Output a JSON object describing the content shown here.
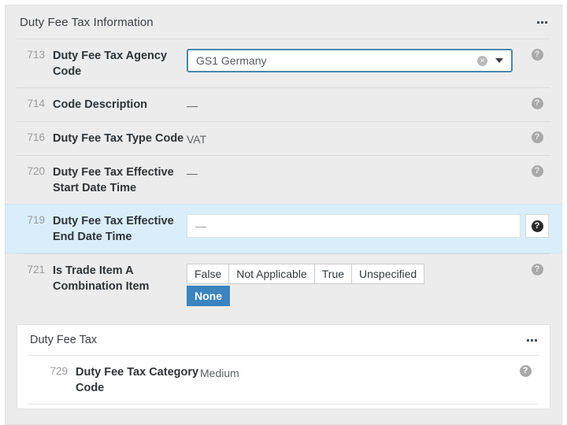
{
  "panel": {
    "title": "Duty Fee Tax Information",
    "menu_icon": "ellipsis-icon",
    "rows": [
      {
        "num": "713",
        "label": "Duty Fee Tax Agency Code",
        "value": "GS1 Germany",
        "type": "select",
        "clear_icon": "clear-circle-icon",
        "caret_icon": "chevron-down-icon",
        "help_icon": "help-circle-icon"
      },
      {
        "num": "714",
        "label": "Code Description",
        "value": "—",
        "type": "text",
        "help_icon": "help-circle-icon"
      },
      {
        "num": "716",
        "label": "Duty Fee Tax Type Code",
        "value": "VAT",
        "type": "text",
        "help_icon": "help-circle-icon"
      },
      {
        "num": "720",
        "label": "Duty Fee Tax Effective Start Date Time",
        "value": "—",
        "type": "text",
        "help_icon": "help-circle-icon"
      },
      {
        "num": "719",
        "label": "Duty Fee Tax Effective End Date Time",
        "value": "—",
        "type": "input",
        "highlighted": true,
        "help_icon": "help-circle-icon"
      },
      {
        "num": "721",
        "label": "Is Trade Item A Combination Item",
        "type": "buttons",
        "options": [
          "False",
          "Not Applicable",
          "True",
          "Unspecified",
          "None"
        ],
        "selected": "None",
        "help_icon": "help-circle-icon"
      }
    ]
  },
  "nested_card": {
    "title": "Duty Fee Tax",
    "menu_icon": "ellipsis-icon",
    "rows": [
      {
        "num": "729",
        "label": "Duty Fee Tax Category Code",
        "value": "Medium",
        "type": "text",
        "help_icon": "help-circle-icon"
      }
    ]
  },
  "colors": {
    "panel_bg": "#ececec",
    "highlight_row": "#d9eefa",
    "accent_blue": "#3b84bf",
    "focus_border": "#4a89a8"
  },
  "glyphs": {
    "help": "?",
    "clear": "×"
  }
}
